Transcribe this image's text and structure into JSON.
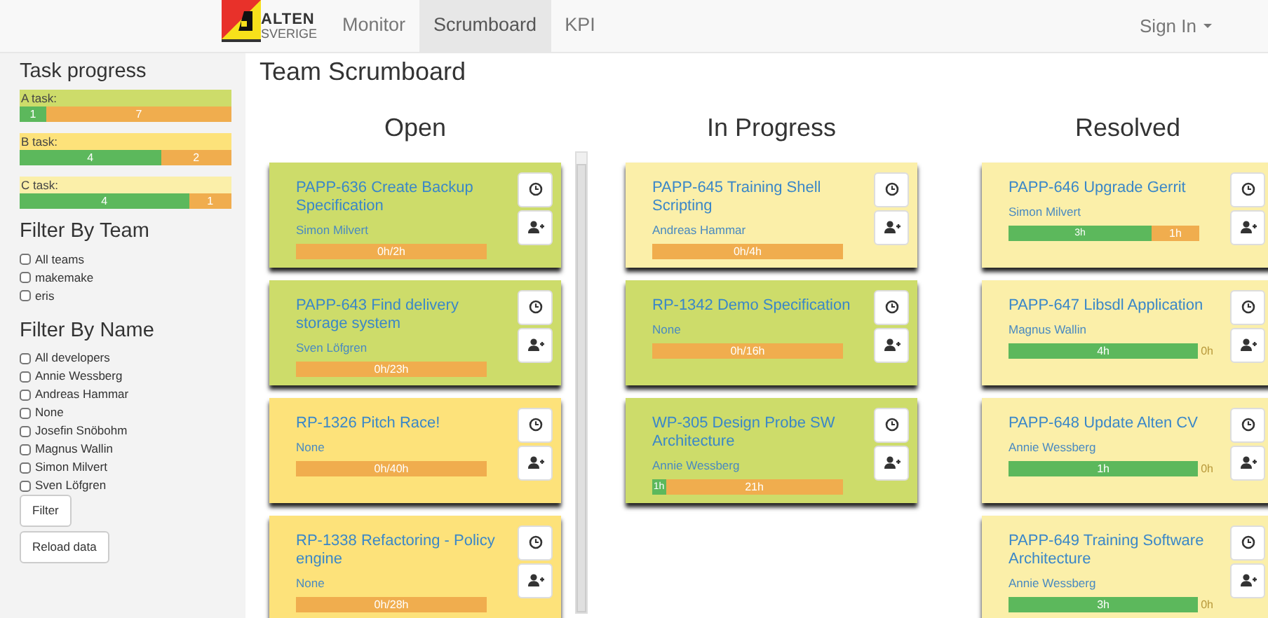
{
  "navbar": {
    "brand": {
      "name": "ALTEN",
      "subtitle": "SVERIGE"
    },
    "nav": [
      {
        "label": "Monitor",
        "selected": false
      },
      {
        "label": "Scrumboard",
        "selected": true
      },
      {
        "label": "KPI",
        "selected": false
      }
    ],
    "user_menu": {
      "label": "Sign In"
    }
  },
  "sidebar": {
    "task_progress": {
      "title": "Task progress",
      "tasks": [
        {
          "label": "A task:",
          "color": "#cddc6a",
          "segments": [
            {
              "label": "1",
              "level": 0.125,
              "kind": "done"
            },
            {
              "label": "7",
              "level": 0.875,
              "kind": "remaining"
            }
          ]
        },
        {
          "label": "B task:",
          "color": "#fde27a",
          "segments": [
            {
              "label": "4",
              "level": 0.667,
              "kind": "done"
            },
            {
              "label": "2",
              "level": 0.333,
              "kind": "remaining"
            }
          ]
        },
        {
          "label": "C task:",
          "color": "#fbefa9",
          "segments": [
            {
              "label": "4",
              "level": 0.8,
              "kind": "done"
            },
            {
              "label": "1",
              "level": 0.2,
              "kind": "remaining"
            }
          ]
        }
      ]
    },
    "filter_team": {
      "title": "Filter By Team",
      "options": [
        {
          "label": "All teams",
          "checked": false
        },
        {
          "label": "makemake",
          "checked": false
        },
        {
          "label": "eris",
          "checked": false
        }
      ]
    },
    "filter_name": {
      "title": "Filter By Name",
      "options": [
        {
          "label": "All developers",
          "checked": false
        },
        {
          "label": "Annie Wessberg",
          "checked": false
        },
        {
          "label": "Andreas Hammar",
          "checked": false
        },
        {
          "label": "None",
          "checked": false
        },
        {
          "label": "Josefin Snöbohm",
          "checked": false
        },
        {
          "label": "Magnus Wallin",
          "checked": false
        },
        {
          "label": "Simon Milvert",
          "checked": false
        },
        {
          "label": "Sven Löfgren",
          "checked": false
        }
      ]
    },
    "buttons": [
      "Filter",
      "Reload data"
    ]
  },
  "board": {
    "title": "Team Scrumboard",
    "columns": [
      {
        "title": "Open",
        "cards": [
          {
            "title": "PAPP-636 Create Backup Specification",
            "assignee": "Simon Milvert",
            "color": "#cddc6a",
            "segments": [
              {
                "label": "0h/2h",
                "level": 1,
                "kind": "remaining"
              }
            ]
          },
          {
            "title": "PAPP-643 Find delivery storage system",
            "assignee": "Sven Löfgren",
            "color": "#cddc6a",
            "segments": [
              {
                "label": "0h/23h",
                "level": 1,
                "kind": "remaining"
              }
            ]
          },
          {
            "title": "RP-1326 Pitch Race!",
            "assignee": "None",
            "color": "#fde27a",
            "segments": [
              {
                "label": "0h/40h",
                "level": 1,
                "kind": "remaining"
              }
            ]
          },
          {
            "title": "RP-1338 Refactoring - Policy engine",
            "assignee": "None",
            "color": "#fde27a",
            "segments": [
              {
                "label": "0h/28h",
                "level": 1,
                "kind": "remaining"
              }
            ]
          }
        ]
      },
      {
        "title": "In Progress",
        "cards": [
          {
            "title": "PAPP-645 Training Shell Scripting",
            "assignee": "Andreas Hammar",
            "color": "#fbefa9",
            "segments": [
              {
                "label": "0h/4h",
                "level": 1,
                "kind": "remaining"
              }
            ]
          },
          {
            "title": "RP-1342 Demo Specification",
            "assignee": "None",
            "color": "#cddc6a",
            "segments": [
              {
                "label": "0h/16h",
                "level": 1,
                "kind": "remaining"
              }
            ]
          },
          {
            "title": "WP-305 Design Probe SW Architecture",
            "assignee": "Annie Wessberg",
            "color": "#cddc6a",
            "segments": [
              {
                "label": "1h",
                "level": 0.07,
                "kind": "done"
              },
              {
                "label": "21h",
                "level": 0.93,
                "kind": "remaining"
              }
            ]
          }
        ]
      },
      {
        "title": "Resolved",
        "cards": [
          {
            "title": "PAPP-646 Upgrade Gerrit",
            "assignee": "Simon Milvert",
            "color": "#fbefa9",
            "segments": [
              {
                "label": "3h",
                "level": 0.75,
                "kind": "done"
              },
              {
                "label": "1h",
                "level": 0.25,
                "kind": "remaining"
              }
            ]
          },
          {
            "title": "PAPP-647 Libsdl Application",
            "assignee": "Magnus Wallin",
            "color": "#fbefa9",
            "segments": [
              {
                "label": "4h",
                "level": 1,
                "kind": "done"
              },
              {
                "label": "0h",
                "kind": "remaining"
              }
            ]
          },
          {
            "title": "PAPP-648 Update Alten CV",
            "assignee": "Annie Wessberg",
            "color": "#fbefa9",
            "segments": [
              {
                "label": "1h",
                "level": 1,
                "kind": "done"
              },
              {
                "label": "0h",
                "kind": "remaining"
              }
            ]
          },
          {
            "title": "PAPP-649 Training Software Architecture",
            "assignee": "Annie Wessberg",
            "color": "#fbefa9",
            "segments": [
              {
                "label": "3h",
                "level": 1,
                "kind": "done"
              },
              {
                "label": "0h",
                "kind": "remaining"
              }
            ]
          }
        ]
      }
    ]
  }
}
